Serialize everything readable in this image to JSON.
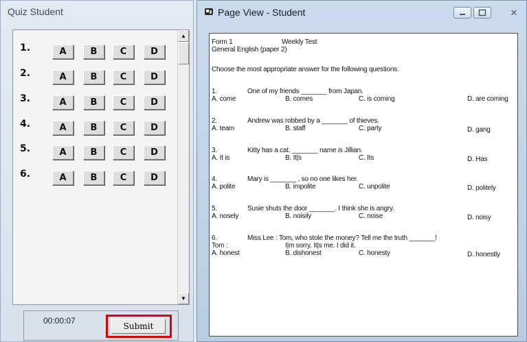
{
  "quiz_panel": {
    "title": "Quiz Student",
    "questions": [
      {
        "number": "1.",
        "options": [
          "A",
          "B",
          "C",
          "D"
        ]
      },
      {
        "number": "2.",
        "options": [
          "A",
          "B",
          "C",
          "D"
        ]
      },
      {
        "number": "3.",
        "options": [
          "A",
          "B",
          "C",
          "D"
        ]
      },
      {
        "number": "4.",
        "options": [
          "A",
          "B",
          "C",
          "D"
        ]
      },
      {
        "number": "5.",
        "options": [
          "A",
          "B",
          "C",
          "D"
        ]
      },
      {
        "number": "6.",
        "options": [
          "A",
          "B",
          "C",
          "D"
        ]
      }
    ],
    "timer": "00:00:07",
    "submit_label": "Submit",
    "highlight_color": "#e00000"
  },
  "page_view": {
    "title": "Page View - Student",
    "header": {
      "form": "Form 1",
      "test": "Weekly Test",
      "subject": "General English (paper 2)"
    },
    "instructions": "Choose the most appropriate answer for the following questions.",
    "questions": [
      {
        "num": "1.",
        "text": "One of my friends _______ from Japan.",
        "options": [
          "A. come",
          "B. comes",
          "C. is coming",
          "D. are coming"
        ]
      },
      {
        "num": "2.",
        "text": "Andrew was robbed by a _______ of thieves.",
        "options": [
          "A. team",
          "B. staff",
          "C. party",
          "D. gang"
        ]
      },
      {
        "num": "3.",
        "text": "Kitty has a cat. _______ name is Jillian.",
        "options": [
          "A. It is",
          "B. It|s",
          "C. Its",
          "D. Has"
        ]
      },
      {
        "num": "4.",
        "text": "Mary is _______ , so no one likes her.",
        "options": [
          "A. polite",
          "B. impolite",
          "C. unpolite",
          "D. politely"
        ]
      },
      {
        "num": "5.",
        "text": "Susie shuts the door _______. I think she is angry.",
        "options": [
          "A. nosely",
          "B. noisily",
          "C. noise",
          "D. noisy"
        ]
      },
      {
        "num": "6.",
        "text": "Miss Lee :          Tom, who stole the money? Tell me the truth _______!",
        "speaker2": "Tom :",
        "text2": "I|m sorry. It|s me. I did it.",
        "options": [
          "A. honest",
          "B. dishonest",
          "C. honesty",
          "D. honestly"
        ]
      }
    ]
  }
}
